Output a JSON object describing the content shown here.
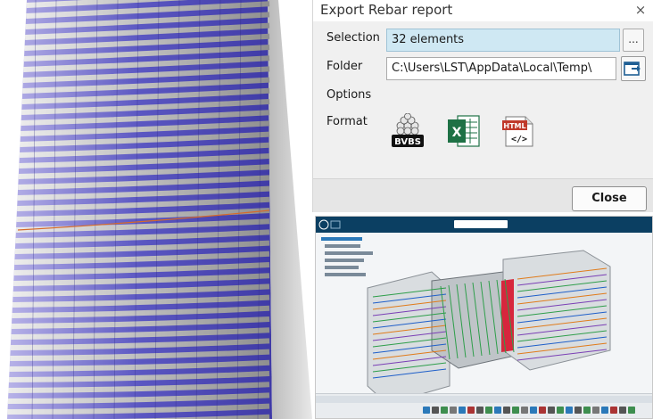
{
  "dialog": {
    "title": "Export Rebar report",
    "close_glyph": "×",
    "selection_label": "Selection",
    "selection_value": "32 elements",
    "browse_label": "...",
    "folder_label": "Folder",
    "folder_value": "C:\\Users\\LST\\AppData\\Local\\Temp\\",
    "options_label": "Options",
    "format_label": "Format",
    "formats": [
      {
        "name": "BVBS",
        "icon": "bvbs-icon",
        "color": "#1a1a1a"
      },
      {
        "name": "Excel",
        "icon": "excel-icon",
        "color": "#1e7145"
      },
      {
        "name": "HTML",
        "icon": "html-icon",
        "color": "#c0392b"
      }
    ],
    "close_button_label": "Close"
  },
  "colors": {
    "selection_highlight": "#cfe8f3",
    "facade_glass": "#5e5bc4",
    "app_topbar": "#0b3f62"
  }
}
